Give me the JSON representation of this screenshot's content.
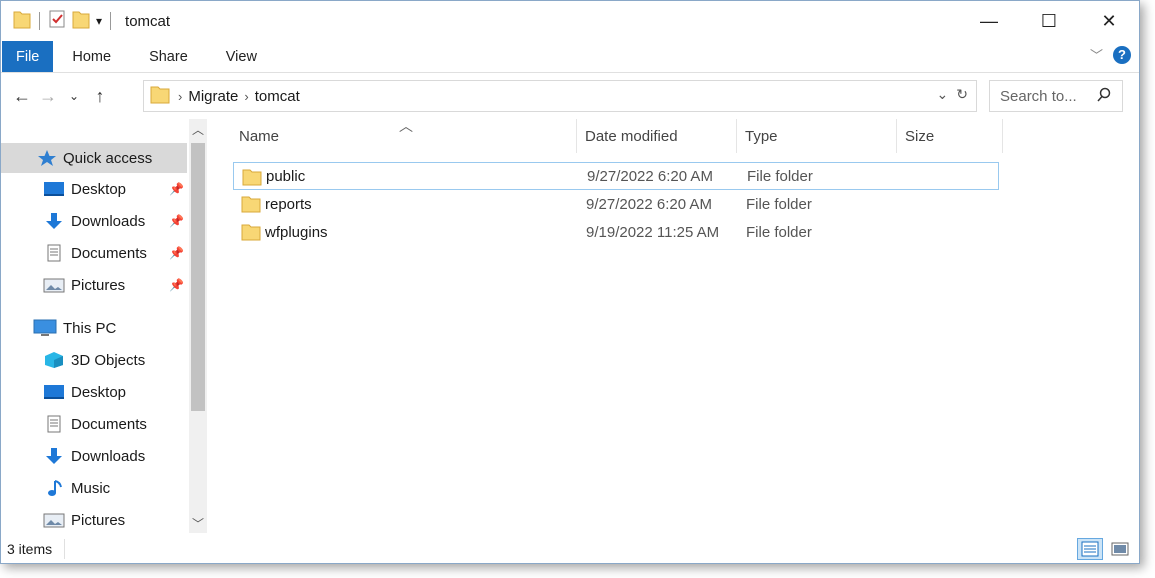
{
  "window": {
    "title": "tomcat"
  },
  "caption": {
    "minimize": "—",
    "maximize": "☐",
    "close": "✕"
  },
  "ribbon": {
    "tabs": [
      "File",
      "Home",
      "Share",
      "View"
    ]
  },
  "address": {
    "crumbs": [
      "Migrate",
      "tomcat"
    ]
  },
  "search": {
    "placeholder": "Search to..."
  },
  "nav": {
    "quick_access": {
      "label": "Quick access"
    },
    "pinned": [
      {
        "label": "Desktop",
        "icon": "desktop-icon"
      },
      {
        "label": "Downloads",
        "icon": "downloads-icon"
      },
      {
        "label": "Documents",
        "icon": "documents-icon"
      },
      {
        "label": "Pictures",
        "icon": "pictures-icon"
      }
    ],
    "this_pc": {
      "label": "This PC"
    },
    "pc_items": [
      {
        "label": "3D Objects",
        "icon": "3d-objects-icon"
      },
      {
        "label": "Desktop",
        "icon": "desktop-icon"
      },
      {
        "label": "Documents",
        "icon": "documents-icon"
      },
      {
        "label": "Downloads",
        "icon": "downloads-icon"
      },
      {
        "label": "Music",
        "icon": "music-icon"
      },
      {
        "label": "Pictures",
        "icon": "pictures-icon"
      }
    ]
  },
  "columns": {
    "name": "Name",
    "date": "Date modified",
    "type": "Type",
    "size": "Size"
  },
  "files": [
    {
      "name": "public",
      "date": "9/27/2022 6:20 AM",
      "type": "File folder"
    },
    {
      "name": "reports",
      "date": "9/27/2022 6:20 AM",
      "type": "File folder"
    },
    {
      "name": "wfplugins",
      "date": "9/19/2022 11:25 AM",
      "type": "File folder"
    }
  ],
  "status": {
    "count": "3 items"
  },
  "colors": {
    "accent": "#1a6fc1",
    "folder": "#f8d775",
    "selection": "#d9d9d9",
    "focus_border": "#99c9ef"
  }
}
